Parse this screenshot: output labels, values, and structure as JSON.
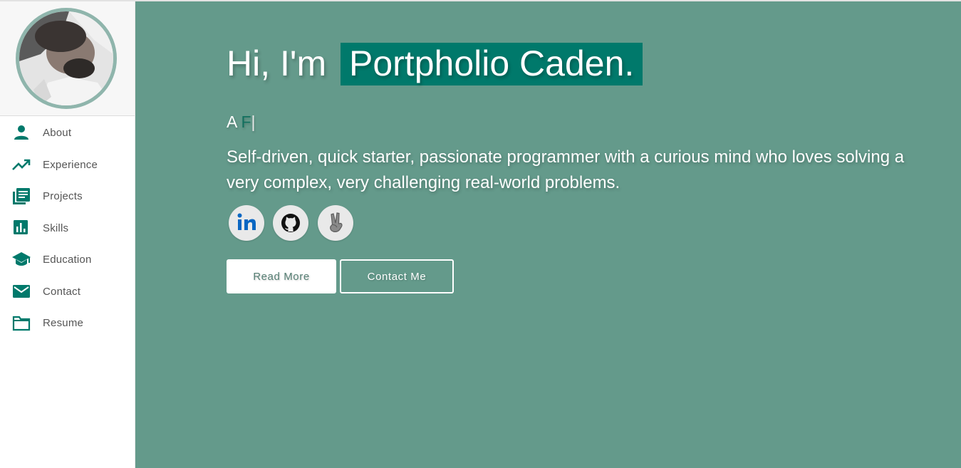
{
  "sidebar": {
    "items": [
      {
        "label": "About",
        "icon": "person-icon"
      },
      {
        "label": "Experience",
        "icon": "trending-up-icon"
      },
      {
        "label": "Projects",
        "icon": "library-books-icon"
      },
      {
        "label": "Skills",
        "icon": "bar-chart-icon"
      },
      {
        "label": "Education",
        "icon": "graduation-cap-icon"
      },
      {
        "label": "Contact",
        "icon": "envelope-icon"
      },
      {
        "label": "Resume",
        "icon": "folder-icon"
      }
    ]
  },
  "hero": {
    "greeting": "Hi, I'm",
    "name": "Portpholio Caden.",
    "typed_prefix": "A ",
    "typed_text": "F",
    "cursor": "|",
    "bio": "Self-driven, quick starter, passionate programmer with a curious mind who loves solving a very complex, very challenging real-world problems.",
    "socials": [
      {
        "name": "linkedin",
        "icon": "linkedin-icon"
      },
      {
        "name": "github",
        "icon": "github-icon"
      },
      {
        "name": "peace",
        "icon": "peace-hand-icon"
      }
    ],
    "buttons": {
      "read_more": "Read More",
      "contact_me": "Contact Me"
    }
  },
  "colors": {
    "accent": "#00796b",
    "main_bg": "#649a8b",
    "sidebar_icon": "#00796b",
    "avatar_border": "#8fb5ac"
  }
}
